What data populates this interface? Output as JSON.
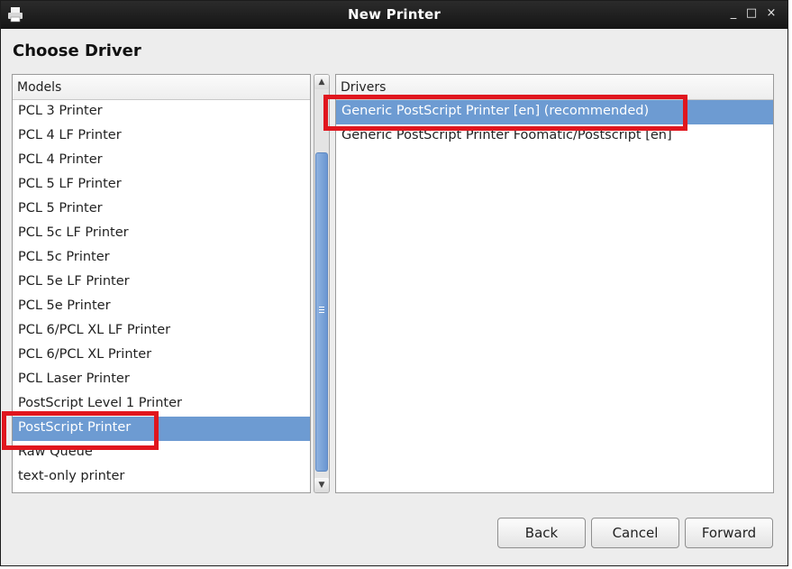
{
  "window": {
    "title": "New Printer",
    "controls": {
      "minimize": "_",
      "maximize": "□",
      "close": "×"
    }
  },
  "heading": "Choose Driver",
  "models": {
    "header": "Models",
    "items": [
      "PCL 3 Printer",
      "PCL 4 LF Printer",
      "PCL 4 Printer",
      "PCL 5 LF Printer",
      "PCL 5 Printer",
      "PCL 5c LF Printer",
      "PCL 5c Printer",
      "PCL 5e LF Printer",
      "PCL 5e Printer",
      "PCL 6/PCL XL LF Printer",
      "PCL 6/PCL XL Printer",
      "PCL Laser Printer",
      "PostScript Level 1 Printer",
      "PostScript Printer",
      "Raw Queue",
      "text-only printer"
    ],
    "selected": "PostScript Printer"
  },
  "drivers": {
    "header": "Drivers",
    "items": [
      "Generic PostScript Printer [en] (recommended)",
      "Generic PostScript Printer Foomatic/Postscript [en]"
    ],
    "selected": "Generic PostScript Printer [en] (recommended)"
  },
  "scrollbar": {
    "up_icon": "▲",
    "down_icon": "▼"
  },
  "buttons": {
    "back": "Back",
    "cancel": "Cancel",
    "forward": "Forward"
  },
  "colors": {
    "selection": "#6d9bd2",
    "highlight_box": "#e0161e",
    "titlebar": "#1e1e1e"
  }
}
